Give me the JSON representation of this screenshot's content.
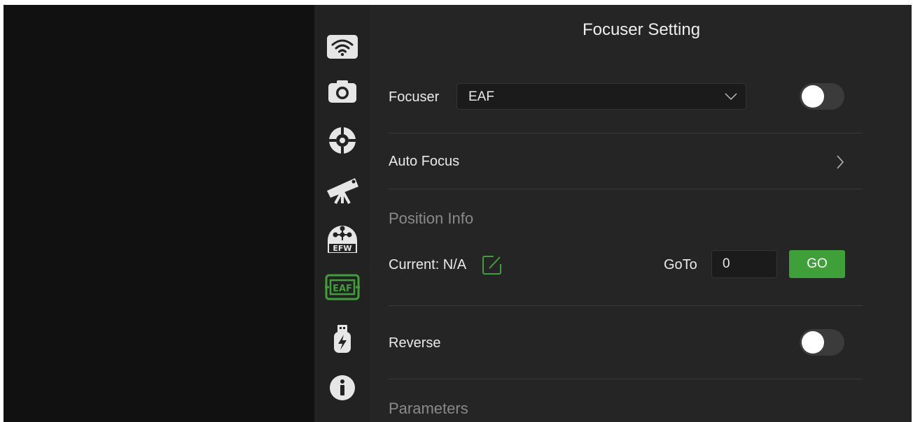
{
  "sidebar": {
    "items": [
      {
        "icon": "wifi-icon",
        "active": false
      },
      {
        "icon": "camera-icon",
        "active": false
      },
      {
        "icon": "crosshair-icon",
        "active": false
      },
      {
        "icon": "telescope-icon",
        "active": false
      },
      {
        "icon": "efw-icon",
        "label": "EFW",
        "active": false
      },
      {
        "icon": "eaf-icon",
        "label": "EAF",
        "active": true
      },
      {
        "icon": "usb-power-icon",
        "active": false
      },
      {
        "icon": "info-icon",
        "active": false
      }
    ]
  },
  "main": {
    "title": "Focuser Setting",
    "focuser": {
      "label": "Focuser",
      "selected": "EAF",
      "enabled": false
    },
    "auto_focus": {
      "label": "Auto Focus"
    },
    "position_info": {
      "section_label": "Position Info",
      "current_label": "Current: N/A",
      "goto_label": "GoTo",
      "goto_value": "0",
      "go_button": "GO"
    },
    "reverse": {
      "label": "Reverse",
      "enabled": false
    },
    "parameters": {
      "section_label": "Parameters"
    }
  },
  "colors": {
    "accent_green": "#3fa03a",
    "background": "#252525",
    "sidebar": "#222222"
  }
}
